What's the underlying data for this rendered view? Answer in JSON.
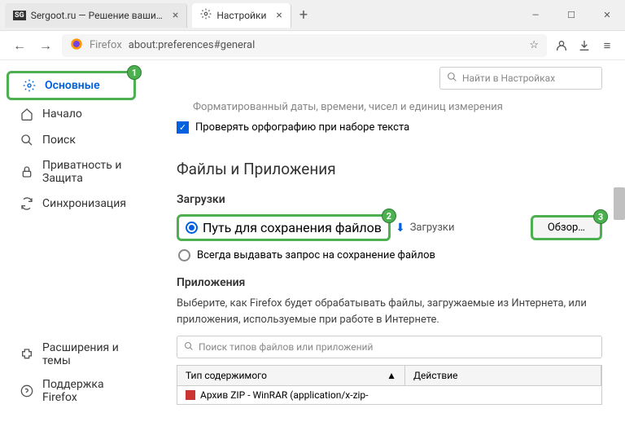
{
  "tabs": [
    {
      "label": "Sergoot.ru — Решение ваши…",
      "favicon": "SG"
    },
    {
      "label": "Настройки",
      "favicon": "gear"
    }
  ],
  "url": {
    "prefix": "Firefox",
    "path": "about:preferences#general"
  },
  "search_placeholder": "Найти в Настройках",
  "sidebar": {
    "items": [
      {
        "label": "Основные",
        "icon": "gear",
        "active": true
      },
      {
        "label": "Начало",
        "icon": "home"
      },
      {
        "label": "Поиск",
        "icon": "search"
      },
      {
        "label": "Приватность и Защита",
        "icon": "lock"
      },
      {
        "label": "Синхронизация",
        "icon": "sync"
      }
    ],
    "bottom": [
      {
        "label": "Расширения и темы",
        "icon": "puzzle"
      },
      {
        "label": "Поддержка Firefox",
        "icon": "question"
      }
    ]
  },
  "truncated_line": "Форматированный даты, времени, чисел и единиц измерения",
  "spellcheck_label": "Проверять орфографию при наборе текста",
  "section_files": "Файлы и Приложения",
  "downloads": {
    "title": "Загрузки",
    "radio_save": "Путь для сохранения файлов",
    "path_label": "Загрузки",
    "browse": "Обзор…",
    "radio_ask": "Всегда выдавать запрос на сохранение файлов"
  },
  "apps": {
    "title": "Приложения",
    "description": "Выберите, как Firefox будет обрабатывать файлы, загружаемые из Интернета, или приложения, используемые при работе в Интернете.",
    "search_placeholder": "Поиск типов файлов или приложений",
    "col_type": "Тип содержимого",
    "col_action": "Действие",
    "row1": "Архив ZIP - WinRAR (application/x-zip-"
  },
  "badges": {
    "b1": "1",
    "b2": "2",
    "b3": "3"
  }
}
